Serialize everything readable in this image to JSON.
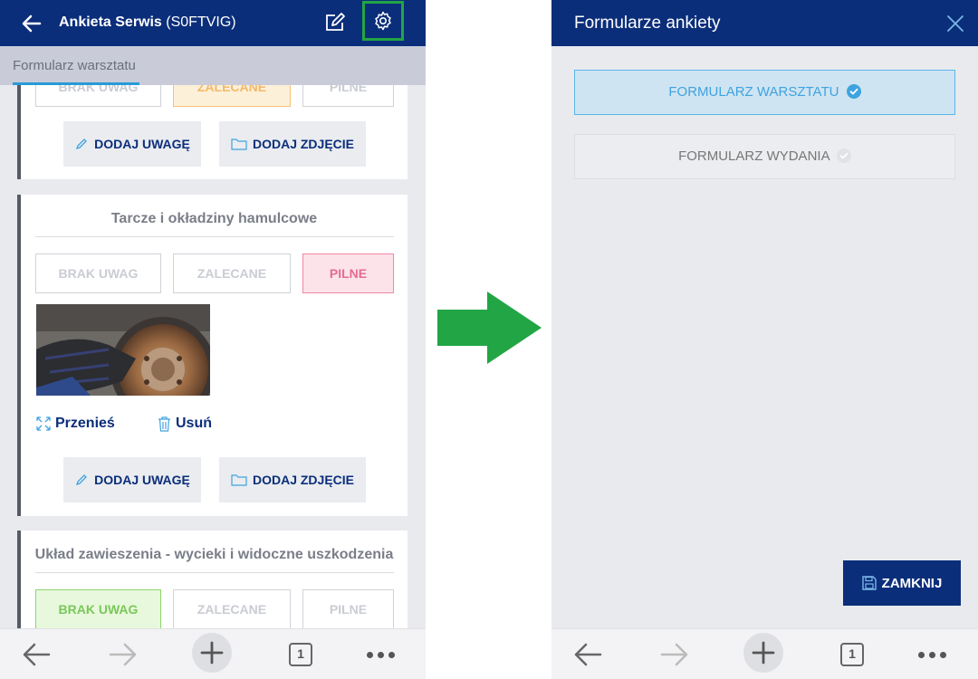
{
  "left": {
    "header": {
      "title_bold": "Ankieta Serwis",
      "title_code": "(S0FTVIG)"
    },
    "subheader": {
      "tab_label": "Formularz warsztatu"
    },
    "cards": [
      {
        "statuses": [
          "BRAK UWAG",
          "ZALECANE",
          "PILNE"
        ],
        "actions": {
          "add_note": "DODAJ UWAGĘ",
          "add_photo": "DODAJ ZDJĘCIE"
        }
      },
      {
        "title": "Tarcze i okładziny hamulcowe",
        "statuses": [
          "BRAK UWAG",
          "ZALECANE",
          "PILNE"
        ],
        "links": {
          "move": "Przenieś",
          "delete": "Usuń"
        },
        "actions": {
          "add_note": "DODAJ UWAGĘ",
          "add_photo": "DODAJ ZDJĘCIE"
        }
      },
      {
        "title": "Układ zawieszenia - wycieki i widoczne uszkodzenia",
        "statuses": [
          "BRAK UWAG",
          "ZALECANE",
          "PILNE"
        ]
      }
    ],
    "bottom_nav": {
      "tabs_count": "1"
    }
  },
  "right": {
    "dialog": {
      "title": "Formularze ankiety",
      "options": [
        {
          "label": "FORMULARZ WARSZTATU",
          "selected": true
        },
        {
          "label": "FORMULARZ WYDANIA",
          "selected": false
        }
      ],
      "close_button": "ZAMKNIJ"
    },
    "bottom_nav": {
      "tabs_count": "1"
    }
  },
  "colors": {
    "primary": "#0b2e7a",
    "accent": "#2a9ad8",
    "highlight": "#22a545",
    "status_orange": "#f3b96a",
    "status_pink": "#e56b91",
    "status_green": "#79c85a"
  },
  "icons": [
    "back-arrow-icon",
    "edit-icon",
    "gear-icon",
    "pencil-icon",
    "folder-icon",
    "move-icon",
    "trash-icon",
    "close-icon",
    "save-icon",
    "check-circle-icon",
    "plus-icon",
    "forward-arrow-icon",
    "tabs-icon",
    "more-icon",
    "arrow-right-icon"
  ]
}
